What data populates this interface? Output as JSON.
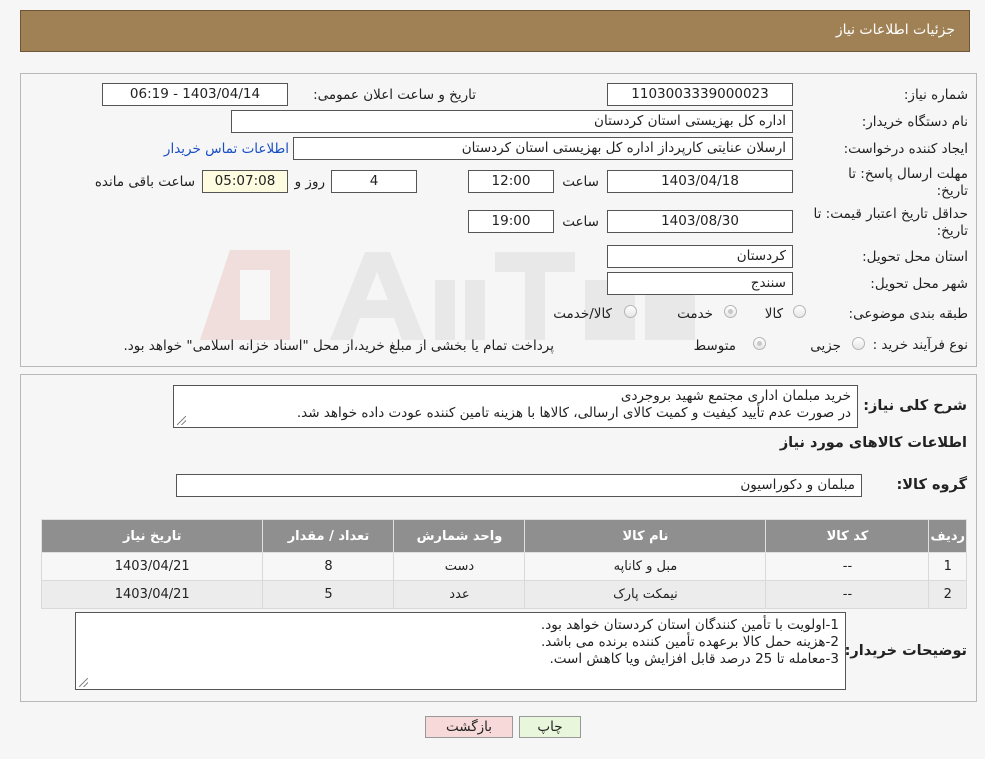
{
  "header": {
    "title": "جزئیات اطلاعات نیاز"
  },
  "form": {
    "need_number_label": "شماره نیاز:",
    "need_number": "1103003339000023",
    "announce_label": "تاریخ و ساعت اعلان عمومی:",
    "announce_value": "1403/04/14 - 06:19",
    "buyer_org_label": "نام دستگاه خریدار:",
    "buyer_org": "اداره کل بهزیستی استان کردستان",
    "creator_label": "ایجاد کننده درخواست:",
    "creator": "ارسلان  عنایتی کارپرداز اداره کل بهزیستی استان کردستان",
    "contact_link": "اطلاعات تماس خریدار",
    "deadline_label": "مهلت ارسال پاسخ: تا تاریخ:",
    "deadline_date": "1403/04/18",
    "time_label": "ساعت",
    "deadline_time": "12:00",
    "days": "4",
    "days_label": "روز و",
    "remaining": "05:07:08",
    "remaining_label": "ساعت باقی مانده",
    "validity_label": "حداقل تاریخ اعتبار قیمت: تا تاریخ:",
    "validity_date": "1403/08/30",
    "validity_time": "19:00",
    "province_label": "استان محل تحویل:",
    "province": "کردستان",
    "city_label": "شهر محل تحویل:",
    "city": "سنندج",
    "category_label": "طبقه بندی موضوعی:",
    "category_options": [
      "کالا",
      "خدمت",
      "کالا/خدمت"
    ],
    "process_label": "نوع فرآیند خرید :",
    "process_options": [
      "جزیی",
      "متوسط"
    ],
    "process_note": "پرداخت تمام یا بخشی از مبلغ خرید،از محل \"اسناد خزانه اسلامی\" خواهد بود."
  },
  "summary": {
    "label": "شرح کلی نیاز:",
    "lines": [
      "خرید مبلمان اداری مجتمع شهید بروجردی",
      "در صورت عدم تأیید کیفیت و کمیت کالای ارسالی، کالاها با هزینه تامین کننده عودت داده خواهد شد."
    ]
  },
  "goods": {
    "title": "اطلاعات کالاهای مورد نیاز",
    "group_label": "گروه کالا:",
    "group_value": "مبلمان و دکوراسیون",
    "columns": [
      "ردیف",
      "کد کالا",
      "نام کالا",
      "واحد شمارش",
      "تعداد / مقدار",
      "تاریخ نیاز"
    ],
    "rows": [
      [
        "1",
        "--",
        "مبل و کاناپه",
        "دست",
        "8",
        "1403/04/21"
      ],
      [
        "2",
        "--",
        "نیمکت پارک",
        "عدد",
        "5",
        "1403/04/21"
      ]
    ]
  },
  "buyer_notes": {
    "label": "توضیحات خریدار:",
    "lines": [
      "1-اولویت با تأمین کنندگان استان کردستان خواهد بود.",
      "2-هزینه حمل کالا برعهده تأمین کننده برنده می باشد.",
      "3-معامله تا 25 درصد قابل افزایش ویا کاهش است."
    ]
  },
  "buttons": {
    "print": "چاپ",
    "back": "بازگشت"
  },
  "colors": {
    "header": "#a08156",
    "back_button": "#f7d9d9",
    "print_button": "#e8f7dc",
    "table_header": "#8f8f8f",
    "link": "#1a4fc4"
  }
}
